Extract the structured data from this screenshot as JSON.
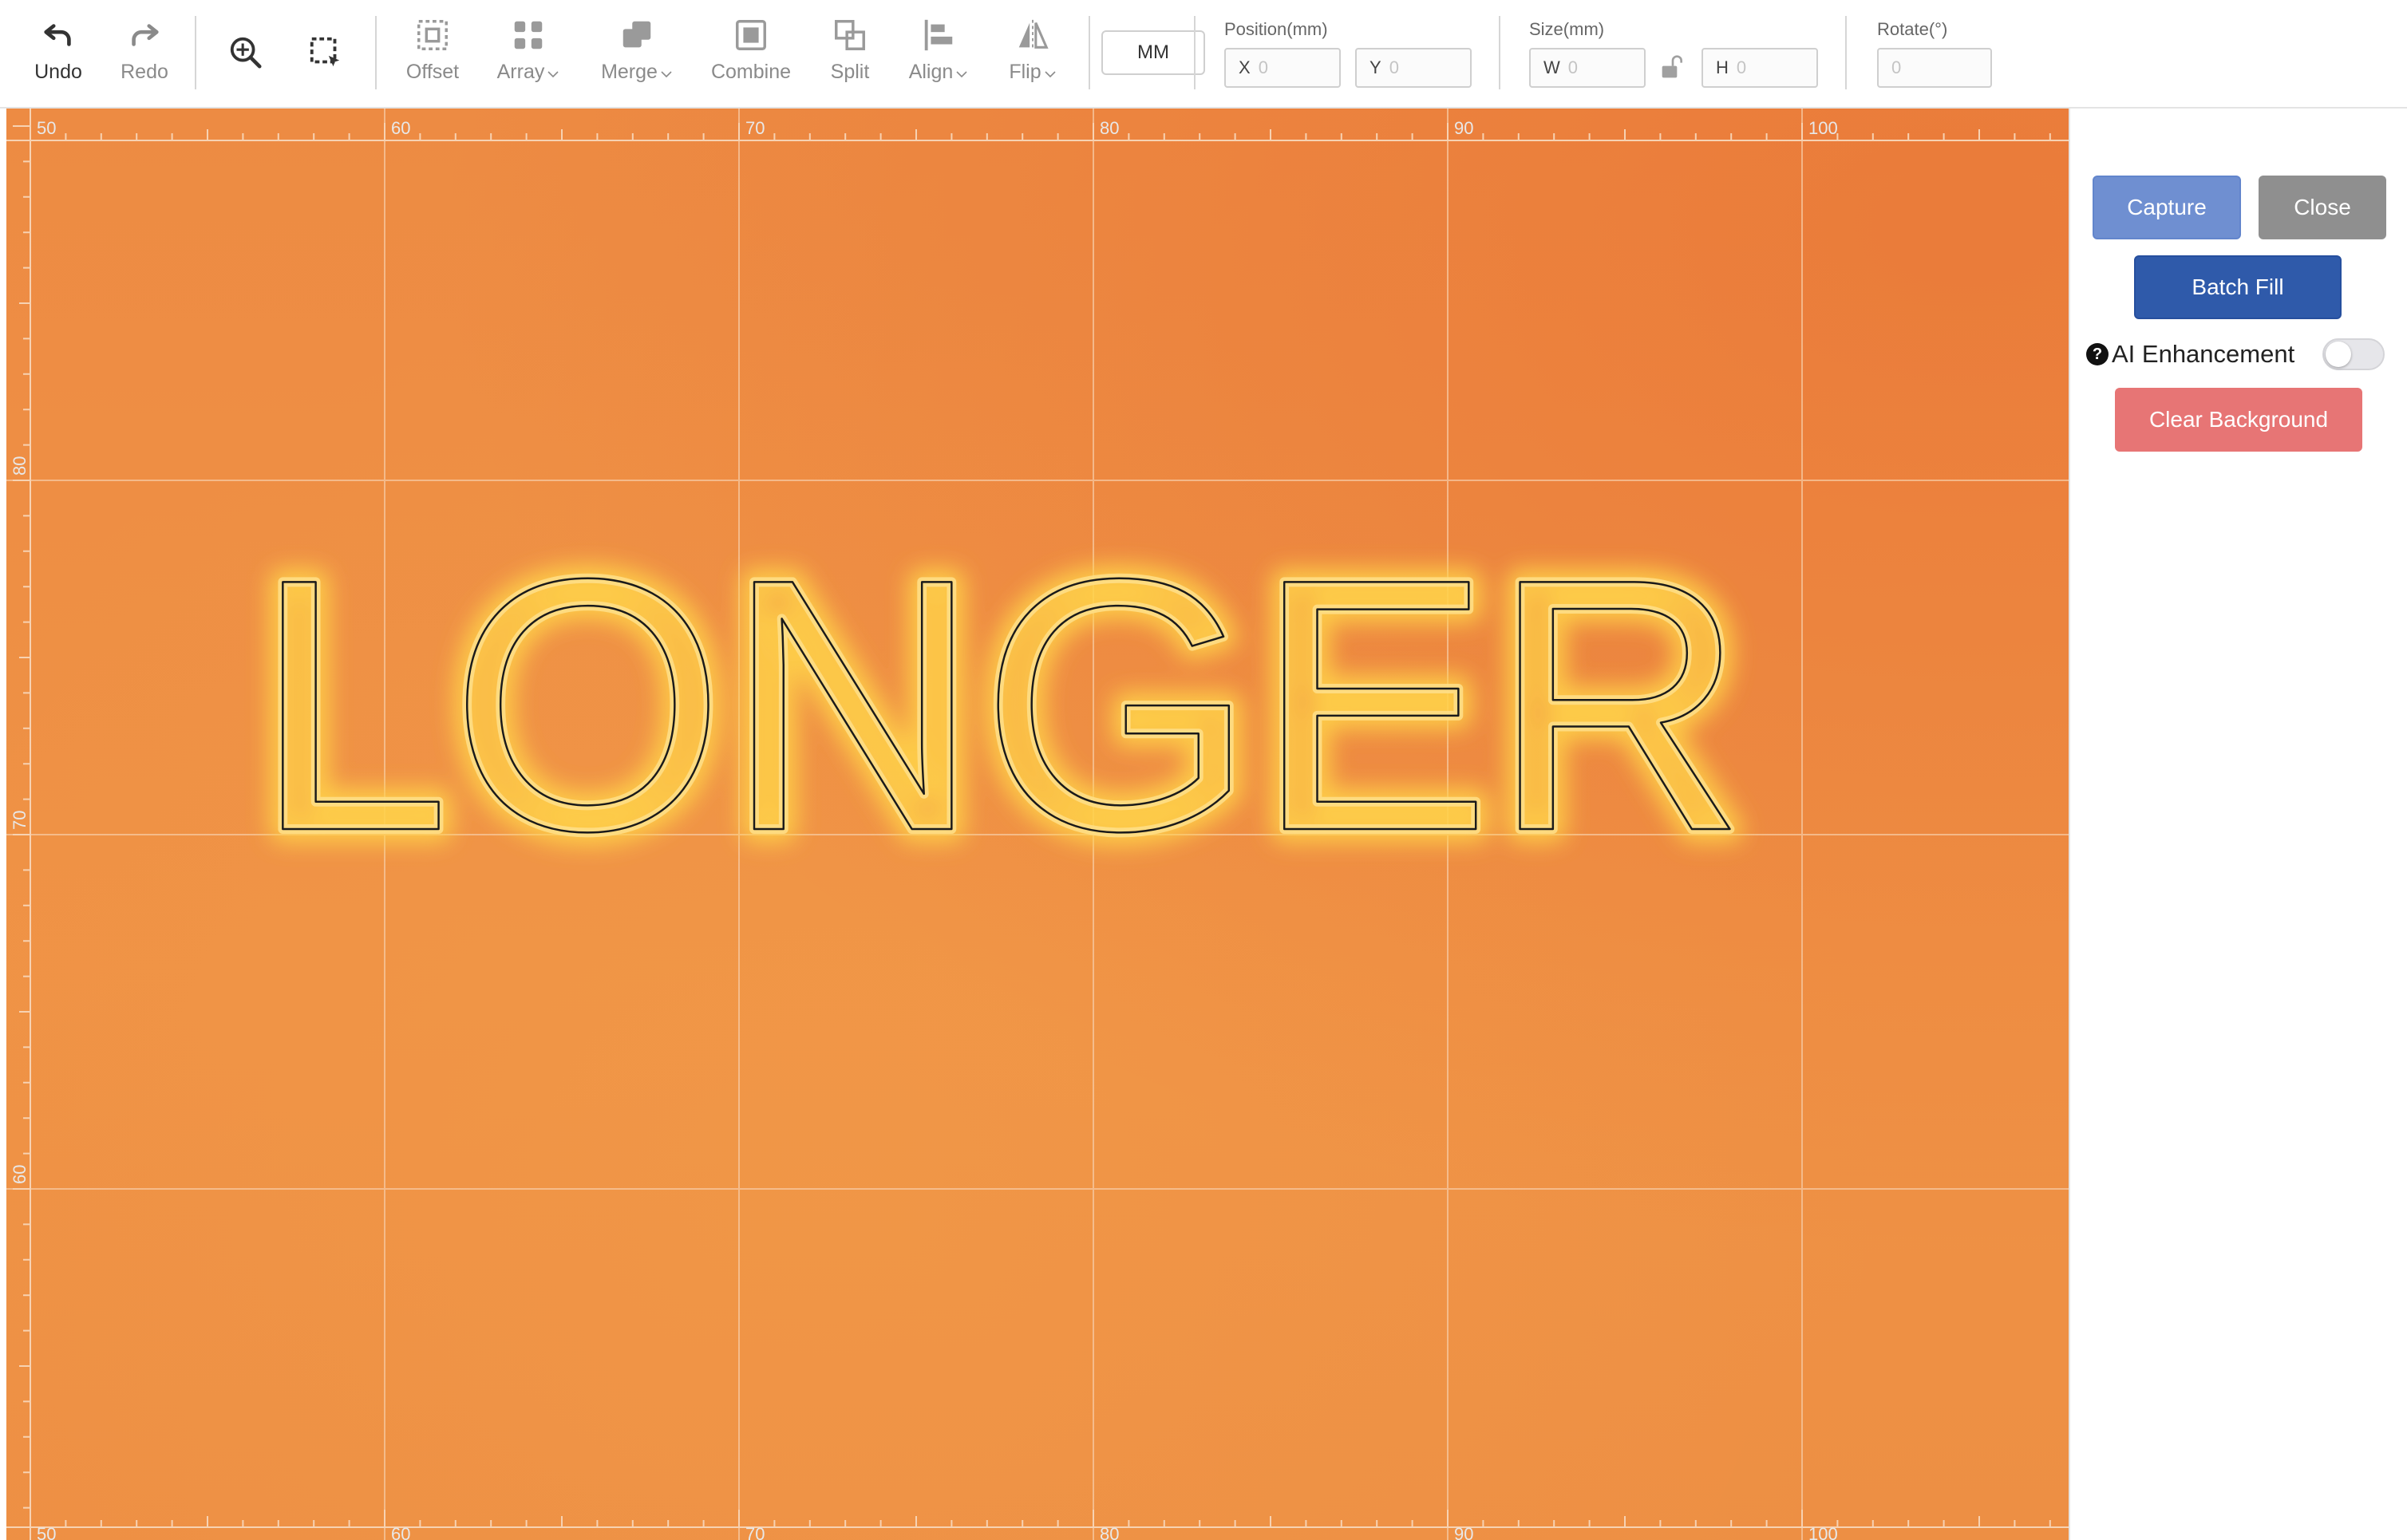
{
  "toolbar": {
    "undo": "Undo",
    "redo": "Redo",
    "offset": "Offset",
    "array": "Array",
    "merge": "Merge",
    "combine": "Combine",
    "split": "Split",
    "align": "Align",
    "flip": "Flip",
    "unit_button": "MM",
    "position_label": "Position(mm)",
    "pos_x_prefix": "X",
    "pos_x_value": "0",
    "pos_y_prefix": "Y",
    "pos_y_value": "0",
    "size_label": "Size(mm)",
    "size_w_prefix": "W",
    "size_w_value": "0",
    "size_h_prefix": "H",
    "size_h_value": "0",
    "rotate_label": "Rotate(°)",
    "rotate_value": "0"
  },
  "canvas": {
    "text": "LONGER",
    "x_ticks": [
      "50",
      "60",
      "70",
      "80",
      "90",
      "100"
    ],
    "y_ticks": [
      "80",
      "70",
      "60"
    ]
  },
  "panel": {
    "capture": "Capture",
    "close": "Close",
    "batch_fill": "Batch Fill",
    "ai_help_icon": "?",
    "ai_enhancement": "AI Enhancement",
    "ai_enhancement_on": false,
    "clear_background": "Clear Background"
  },
  "colors": {
    "capture": "#6f8fd1",
    "close": "#8f8f8f",
    "batch_fill": "#2f5aaa",
    "clear_background": "#e77575",
    "canvas": "#ee8e44"
  }
}
